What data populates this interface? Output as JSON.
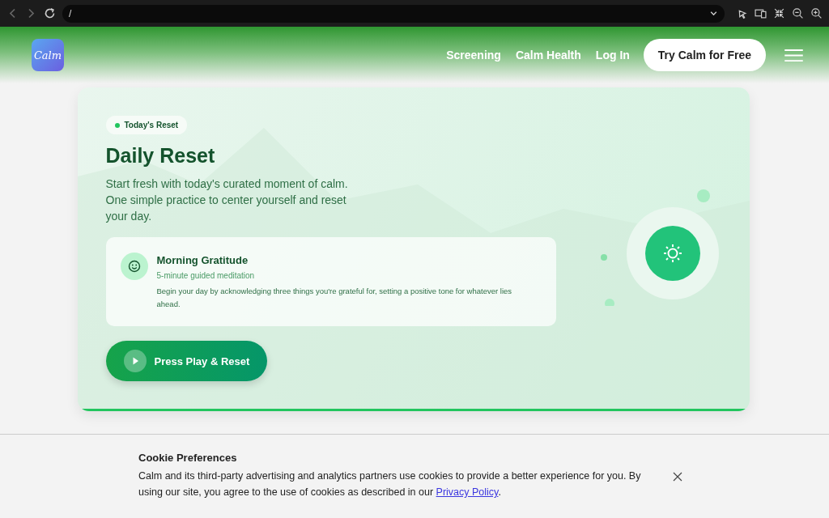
{
  "browser": {
    "address": "/"
  },
  "nav": {
    "links": [
      "Screening",
      "Calm Health",
      "Log In"
    ],
    "cta": "Try Calm for Free"
  },
  "logo": {
    "text": "Calm"
  },
  "hero": {
    "badge": "Today's Reset",
    "title": "Daily Reset",
    "subtitle": "Start fresh with today's curated moment of calm. One simple practice to center yourself and reset your day.",
    "practice": {
      "title": "Morning Gratitude",
      "meta": "5-minute guided meditation",
      "description": "Begin your day by acknowledging three things you're grateful for, setting a positive tone for whatever lies ahead."
    },
    "play_button": "Press Play & Reset"
  },
  "cookie": {
    "title": "Cookie Preferences",
    "text_before": "Calm and its third-party advertising and analytics partners use cookies to provide a better experience for you. By using our site, you agree to the use of cookies as described in our ",
    "link": "Privacy Policy",
    "text_after": "."
  }
}
